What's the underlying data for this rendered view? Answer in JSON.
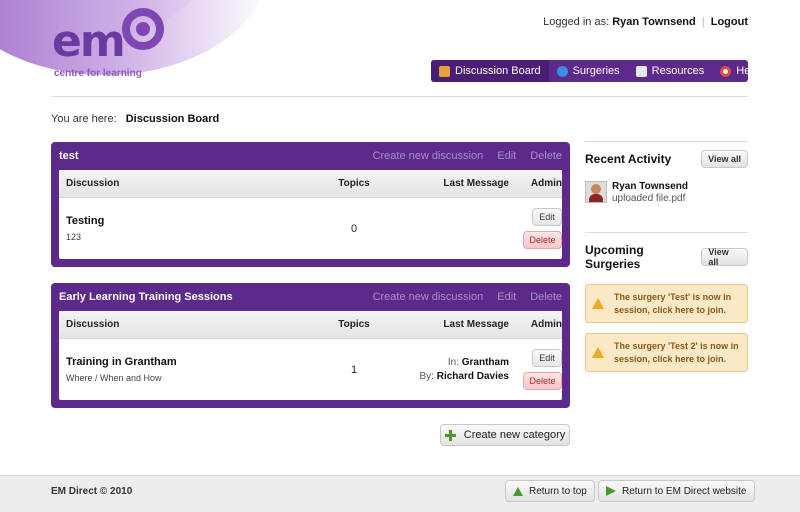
{
  "logo": {
    "mark": "em",
    "tagline": "centre for learning"
  },
  "header": {
    "logged_in_label": "Logged in as:",
    "user_name": "Ryan Townsend",
    "logout": "Logout"
  },
  "nav": [
    {
      "label": "Discussion Board",
      "icon": "board-icon",
      "color": "#e8a23a"
    },
    {
      "label": "Surgeries",
      "icon": "globe-icon",
      "color": "#3d8ee0"
    },
    {
      "label": "Resources",
      "icon": "document-icon",
      "color": "#e8e8e8"
    },
    {
      "label": "Help",
      "icon": "lifebuoy-icon",
      "color": "#e04b3d"
    }
  ],
  "breadcrumb": {
    "label": "You are here:",
    "current": "Discussion Board"
  },
  "categories": [
    {
      "title": "test",
      "actions": {
        "create": "Create new discussion",
        "edit": "Edit",
        "delete": "Delete"
      },
      "columns": {
        "discussion": "Discussion",
        "topics": "Topics",
        "last_message": "Last Message",
        "admin": "Admin"
      },
      "rows": [
        {
          "title": "Testing",
          "subtitle": "123",
          "topics": "0",
          "last_in": "",
          "last_in_label": "",
          "last_by": "",
          "last_by_label": "",
          "edit": "Edit",
          "delete": "Delete"
        }
      ]
    },
    {
      "title": "Early Learning Training Sessions",
      "actions": {
        "create": "Create new discussion",
        "edit": "Edit",
        "delete": "Delete"
      },
      "columns": {
        "discussion": "Discussion",
        "topics": "Topics",
        "last_message": "Last Message",
        "admin": "Admin"
      },
      "rows": [
        {
          "title": "Training in Grantham",
          "subtitle": "Where / When and How",
          "topics": "1",
          "last_in_label": "In:",
          "last_in": "Grantham",
          "last_by_label": "By:",
          "last_by": "Richard Davies",
          "edit": "Edit",
          "delete": "Delete"
        }
      ]
    }
  ],
  "create_category": "Create new category",
  "sidebar": {
    "recent": {
      "title": "Recent Activity",
      "view_all": "View all",
      "items": [
        {
          "name": "Ryan Townsend",
          "text": "uploaded file.pdf"
        }
      ]
    },
    "surgeries": {
      "title": "Upcoming Surgeries",
      "view_all": "View all",
      "alerts": [
        "The surgery 'Test' is now in session, click here to join.",
        "The surgery 'Test 2' is now in session, click here to join."
      ]
    }
  },
  "footer": {
    "copyright": "EM Direct © 2010",
    "return_top": "Return to top",
    "return_site": "Return to EM Direct website"
  },
  "colors": {
    "brand_purple": "#5d2a8c",
    "alert_bg": "#fbe8c6",
    "delete_red": "#b22222"
  }
}
